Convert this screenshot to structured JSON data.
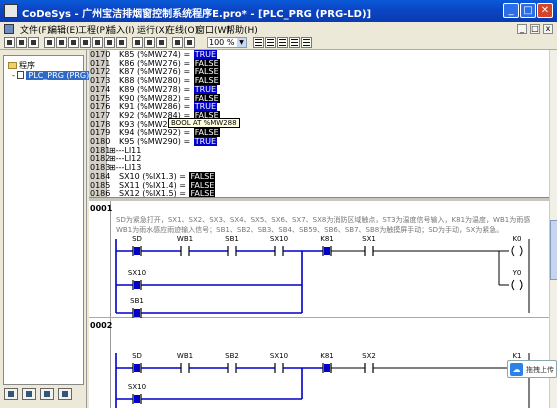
{
  "window": {
    "title": "CoDeSys - 广州宝洁排烟窗控制系统程序E.pro* - [PLC_PRG (PRG-LD)]",
    "minimize": "_",
    "maximize": "□",
    "close": "✕"
  },
  "menu": {
    "items": [
      "文件(F)",
      "编辑(E)",
      "工程(P)",
      "插入(I)",
      "运行(X)",
      "在线(O)",
      "窗口(W)",
      "帮助(H)"
    ],
    "mdi_buttons": [
      "_",
      "□",
      "x"
    ]
  },
  "toolbar": {
    "zoom": "100 %",
    "zoom_arrow": "▼"
  },
  "tree": {
    "root": "程序",
    "expander": "-",
    "pou": "PLC_PRG (PRG)"
  },
  "declarations": [
    {
      "ln": "0170",
      "text": "K85 (%MW274) = ",
      "value": "TRUE"
    },
    {
      "ln": "0171",
      "text": "K86 (%MW276) = ",
      "value": "FALSE"
    },
    {
      "ln": "0172",
      "text": "K87 (%MW276) = ",
      "value": "FALSE"
    },
    {
      "ln": "0173",
      "text": "K88 (%MW280) = ",
      "value": "FALSE"
    },
    {
      "ln": "0174",
      "text": "K89 (%MW278) = ",
      "value": "TRUE"
    },
    {
      "ln": "0175",
      "text": "K90 (%MW282) = ",
      "value": "FALSE"
    },
    {
      "ln": "0176",
      "text": "K91 (%MW286) = ",
      "value": "TRUE"
    },
    {
      "ln": "0177",
      "text": "K92 (%MW284) = ",
      "value": "FALSE"
    },
    {
      "ln": "0178",
      "text": "K93 (%MW288) = ",
      "value": ""
    },
    {
      "ln": "0179",
      "text": "K94 (%MW292) = ",
      "value": "FALSE"
    },
    {
      "ln": "0180",
      "text": "K95 (%MW290) = ",
      "value": "TRUE"
    },
    {
      "ln": "0181",
      "text": "⊞---LI11",
      "value": ""
    },
    {
      "ln": "0182",
      "text": "⊞---LI12",
      "value": ""
    },
    {
      "ln": "0183",
      "text": "⊞---LI13",
      "value": ""
    },
    {
      "ln": "0184",
      "text": "SX10 (%IX1.3) = ",
      "value": "FALSE"
    },
    {
      "ln": "0185",
      "text": "SX11 (%IX1.4) = ",
      "value": "FALSE"
    },
    {
      "ln": "0186",
      "text": "SX12 (%IX1.5) = ",
      "value": "FALSE"
    }
  ],
  "tooltip": "BOOL AT %MW288",
  "networks": [
    {
      "id": "0001",
      "comment_lines": [
        "SD为紧急打开，SX1、SX2、SX3、SX4、SX5、SX6、SX7、SX8为消防区域触点，ST3为温度信号输入，K81为温度，WB1为雨感",
        "WB1为雨水感应雨迹输入信号；SB1、SB2、SB3、SB4、SB59、SB6、SB7、SB8为触摸屏手动；SD为手动，SX为紧急。"
      ],
      "contacts": [
        "SD",
        "WB1",
        "SB1",
        "SX10",
        "K81",
        "SX1"
      ],
      "branch_contacts": [
        "SX10",
        "SB1"
      ],
      "coils": [
        "K0",
        "Y0"
      ]
    },
    {
      "id": "0002",
      "comment_lines": [],
      "contacts": [
        "SD",
        "WB1",
        "SB2",
        "SX10",
        "K81",
        "SX2"
      ],
      "branch_contacts": [
        "SX10"
      ],
      "coils": [
        "K1"
      ]
    }
  ],
  "float_button": {
    "label": "拖拽上传"
  },
  "colors": {
    "true_bg": "#0000c8",
    "false_bg": "#000000",
    "titlebar": "#0a46c4",
    "highlight_contact": "#0000c8"
  }
}
